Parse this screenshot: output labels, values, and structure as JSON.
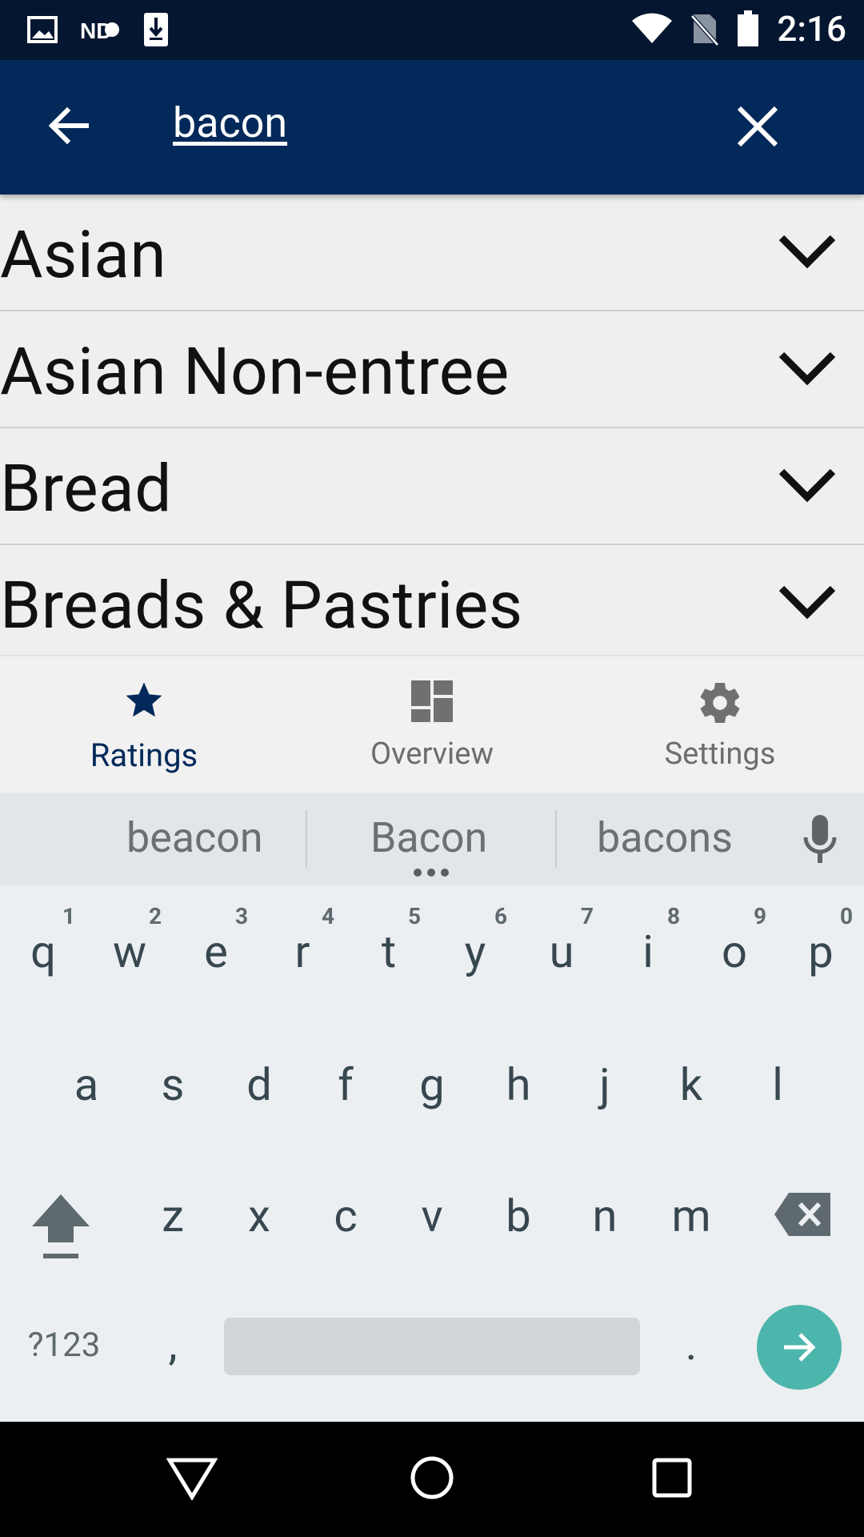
{
  "status_bar": {
    "time": "2:16",
    "icons_left": [
      "image-icon",
      "nd-icon",
      "download-icon"
    ],
    "icons_right": [
      "wifi-icon",
      "no-sim-icon",
      "battery-icon"
    ]
  },
  "app_bar": {
    "search_query": "bacon",
    "back_icon": "arrow-left-icon",
    "clear_icon": "close-icon",
    "background_color": "#03295a"
  },
  "categories": [
    {
      "label": "Asian"
    },
    {
      "label": "Asian Non-entree"
    },
    {
      "label": "Bread"
    },
    {
      "label": "Breads & Pastries"
    }
  ],
  "bottom_nav": {
    "items": [
      {
        "label": "Ratings",
        "icon": "star-icon",
        "active": true
      },
      {
        "label": "Overview",
        "icon": "dashboard-icon",
        "active": false
      },
      {
        "label": "Settings",
        "icon": "gear-icon",
        "active": false
      }
    ]
  },
  "suggestions": {
    "items": [
      "beacon",
      "Bacon",
      "bacons"
    ],
    "mic_icon": "microphone-icon"
  },
  "keyboard": {
    "row1": [
      "q",
      "w",
      "e",
      "r",
      "t",
      "y",
      "u",
      "i",
      "o",
      "p"
    ],
    "row1_hints": [
      "1",
      "2",
      "3",
      "4",
      "5",
      "6",
      "7",
      "8",
      "9",
      "0"
    ],
    "row2": [
      "a",
      "s",
      "d",
      "f",
      "g",
      "h",
      "j",
      "k",
      "l"
    ],
    "row3": [
      "z",
      "x",
      "c",
      "v",
      "b",
      "n",
      "m"
    ],
    "symbols_label": "?123",
    "comma": ",",
    "period": ".",
    "accent_color": "#4db6ac"
  }
}
